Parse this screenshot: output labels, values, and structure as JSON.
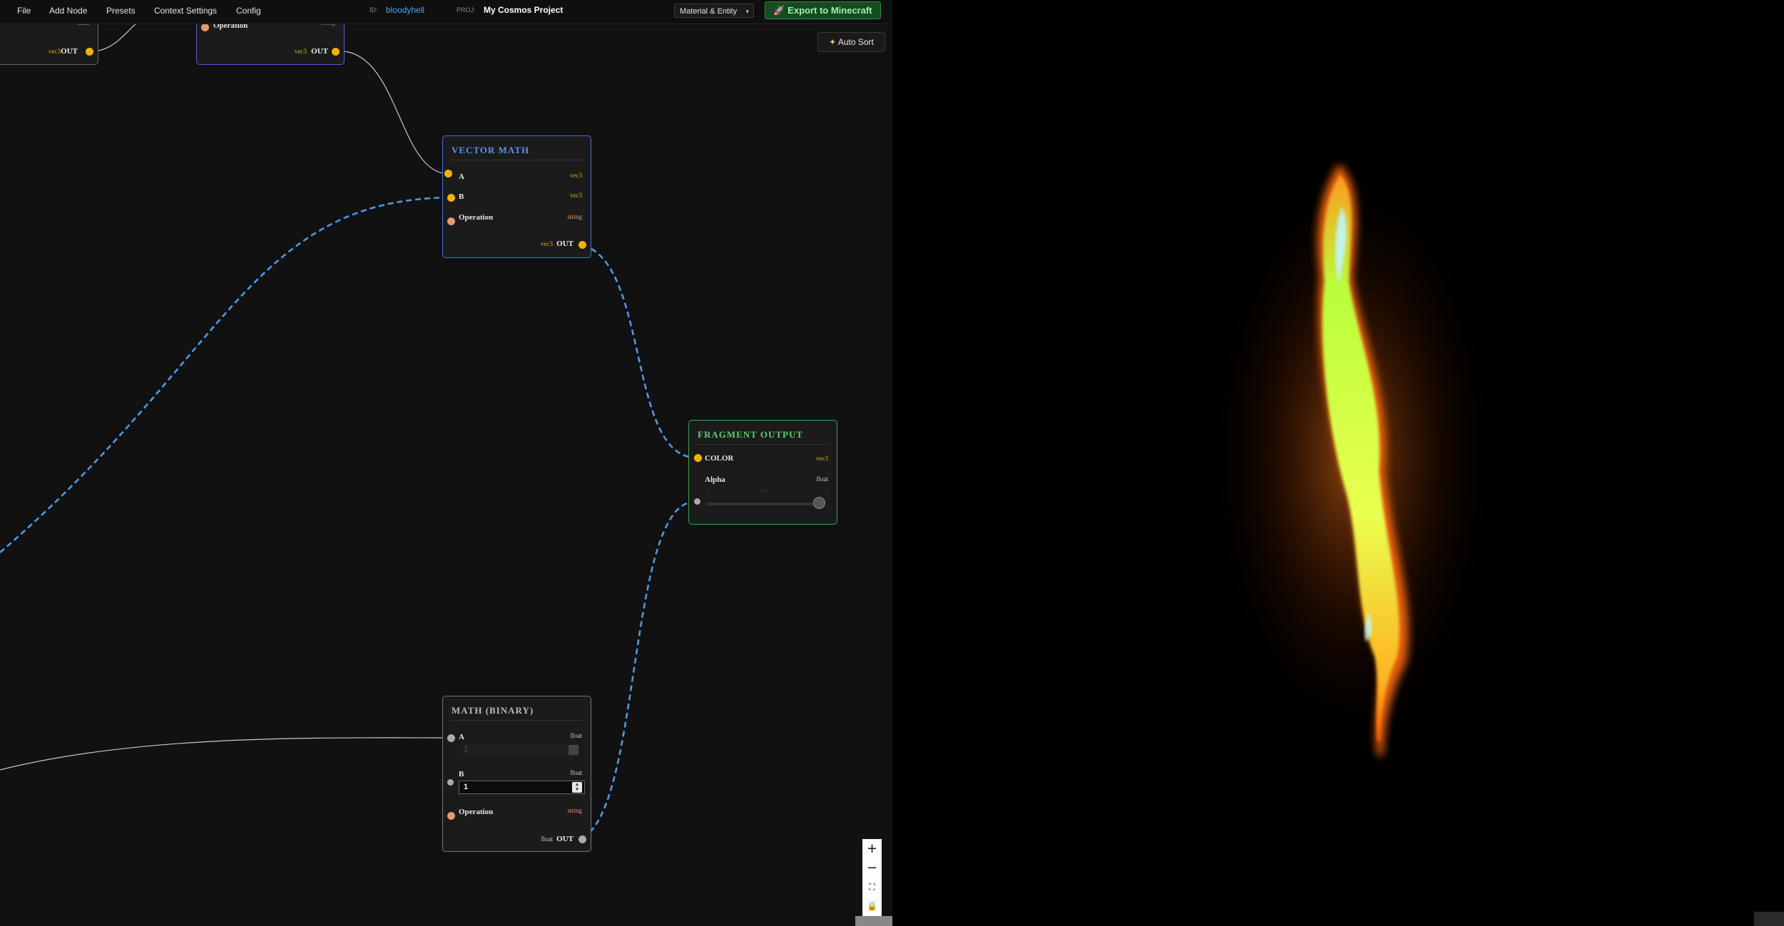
{
  "menu": {
    "file": "File",
    "add_node": "Add Node",
    "presets": "Presets",
    "context_settings": "Context Settings",
    "config": "Config"
  },
  "meta": {
    "id_label": "ID:",
    "id_value": "bloodyhell",
    "proj_label": "PROJ:",
    "proj_value": "My Cosmos Project"
  },
  "mode_select": {
    "value": "Material & Entity"
  },
  "export_button": {
    "icon": "rocket-icon",
    "label": "Export to Minecraft"
  },
  "auto_sort_button": {
    "icon": "magic-wand-icon",
    "label": "Auto Sort"
  },
  "nodes": {
    "partial_left": {
      "in_type": "float",
      "out_type": "vec3",
      "out_label": "OUT"
    },
    "partial_top": {
      "op_label": "Operation",
      "op_type": "string",
      "out_type": "vec3",
      "out_label": "OUT"
    },
    "vector_math": {
      "title": "VECTOR MATH",
      "inputs": [
        {
          "label": "A",
          "type": "vec3"
        },
        {
          "label": "B",
          "type": "vec3"
        },
        {
          "label": "Operation",
          "type": "string"
        }
      ],
      "out_type": "vec3",
      "out_label": "OUT"
    },
    "fragment_output": {
      "title": "FRAGMENT OUTPUT",
      "inputs": [
        {
          "label": "COLOR",
          "type": "vec3"
        },
        {
          "label": "Alpha",
          "type": "float"
        }
      ],
      "slider": {
        "min": "0",
        "mid": "0.5",
        "max": "1",
        "value": 1.0
      }
    },
    "math_binary": {
      "title": "MATH (BINARY)",
      "inputs": [
        {
          "label": "A",
          "type": "float",
          "value": "1"
        },
        {
          "label": "B",
          "type": "float",
          "value": "1"
        },
        {
          "label": "Operation",
          "type": "string"
        }
      ],
      "out_type": "float",
      "out_label": "OUT"
    }
  },
  "zoom_controls": {
    "zoom_in": "+",
    "zoom_out": "−",
    "fit_icon": "fit-view-icon",
    "lock_icon": "lock-icon"
  },
  "colors": {
    "accent_blue": "#4a90e2",
    "vec3_port": "#f2b400",
    "string_port": "#e59a70",
    "float_port": "#aaaaaa",
    "frag_border": "#3fa24f",
    "export_green": "#2f8a3e"
  },
  "preview": {
    "content": "green-yellow flame streak on black background"
  }
}
